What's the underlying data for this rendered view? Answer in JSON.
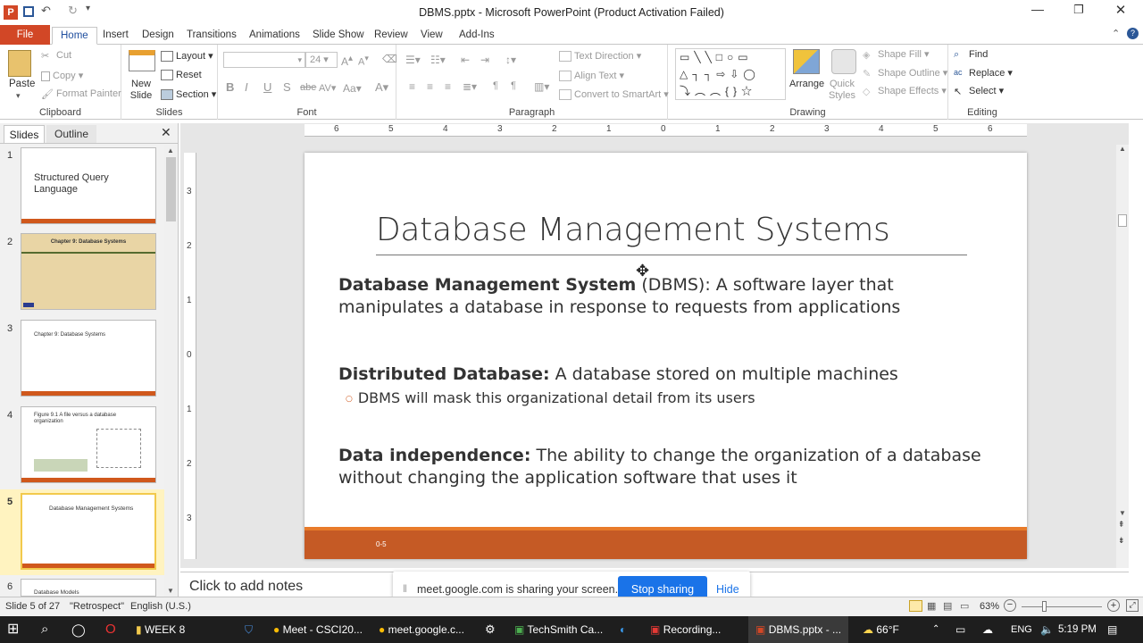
{
  "window": {
    "title": "DBMS.pptx - Microsoft PowerPoint (Product Activation Failed)"
  },
  "tabs": [
    "File",
    "Home",
    "Insert",
    "Design",
    "Transitions",
    "Animations",
    "Slide Show",
    "Review",
    "View",
    "Add-Ins"
  ],
  "ribbon": {
    "clipboard": {
      "label": "Clipboard",
      "paste": "Paste",
      "cut": "Cut",
      "copy": "Copy",
      "format_painter": "Format Painter"
    },
    "slides": {
      "label": "Slides",
      "new_slide": "New Slide",
      "layout": "Layout",
      "reset": "Reset",
      "section": "Section"
    },
    "font": {
      "label": "Font",
      "size": "24",
      "bold": "B",
      "italic": "I",
      "underline": "U",
      "strike": "S",
      "abc": "abe",
      "av": "AV",
      "aa": "Aa",
      "a": "A"
    },
    "paragraph": {
      "label": "Paragraph",
      "text_direction": "Text Direction",
      "align_text": "Align Text",
      "convert": "Convert to SmartArt"
    },
    "drawing": {
      "label": "Drawing",
      "arrange": "Arrange",
      "quick_styles": "Quick Styles",
      "shape_fill": "Shape Fill",
      "shape_outline": "Shape Outline",
      "shape_effects": "Shape Effects"
    },
    "editing": {
      "label": "Editing",
      "find": "Find",
      "replace": "Replace",
      "select": "Select"
    }
  },
  "pane_tabs": {
    "slides": "Slides",
    "outline": "Outline"
  },
  "thumbnails": [
    {
      "num": "1",
      "title": "Structured Query Language"
    },
    {
      "num": "2",
      "title": "Chapter 9: Database Systems"
    },
    {
      "num": "3",
      "title": "Chapter 9: Database Systems"
    },
    {
      "num": "4",
      "title": "Figure 9.1 A file versus a database organization"
    },
    {
      "num": "5",
      "title": "Database Management Systems"
    },
    {
      "num": "6",
      "title": "Database Models"
    }
  ],
  "ruler": {
    "h": [
      "6",
      "5",
      "4",
      "3",
      "2",
      "1",
      "0",
      "1",
      "2",
      "3",
      "4",
      "5",
      "6"
    ],
    "v": [
      "3",
      "2",
      "1",
      "0",
      "1",
      "2",
      "3"
    ]
  },
  "slide": {
    "title": "Database Management Systems",
    "b1_bold": "Database Management System",
    "b1_rest": " (DBMS): A software layer that manipulates a database in response to requests from applications",
    "b2_bold": "Distributed Database:",
    "b2_rest": " A database stored on multiple machines",
    "b2_sub": "DBMS will mask this organizational detail from its users",
    "b3_bold": "Data independence:",
    "b3_rest": " The ability to change the organization of a database without changing the application software that uses it",
    "footer_num": "0-5"
  },
  "notes": {
    "placeholder": "Click to add notes"
  },
  "share": {
    "text": "meet.google.com is sharing your screen.",
    "stop": "Stop sharing",
    "hide": "Hide"
  },
  "status": {
    "slide": "Slide 5 of 27",
    "theme": "\"Retrospect\"",
    "language": "English (U.S.)",
    "zoom": "63%"
  },
  "taskbar": {
    "week": "WEEK 8",
    "meet": "Meet - CSCI20...",
    "meet2": "meet.google.c...",
    "techsmith": "TechSmith Ca...",
    "recording": "Recording...",
    "dbms": "DBMS.pptx - ...",
    "weather": "66°F",
    "lang": "ENG",
    "time": "5:19 PM"
  },
  "colors": {
    "accent": "#d24726",
    "footer": "#c55a25",
    "footer_top": "#e87b2a"
  }
}
